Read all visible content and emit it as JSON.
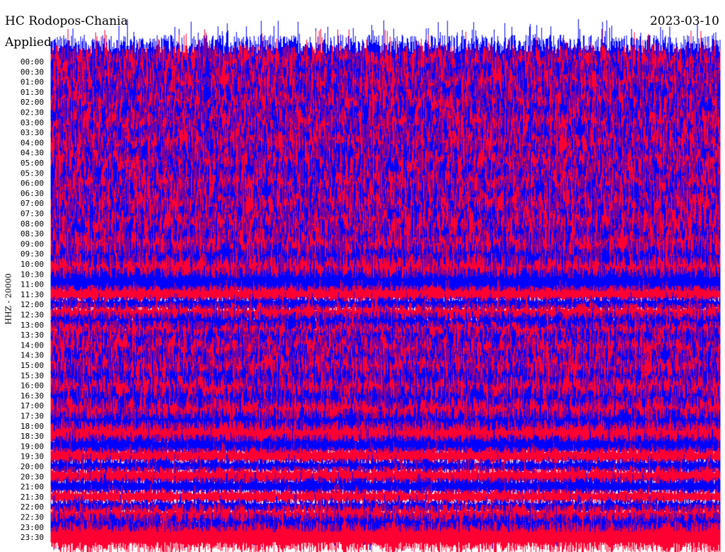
{
  "header": {
    "station": "HC Rodopos-Chania",
    "filter_label": "Applied",
    "date": "2023-03-10"
  },
  "chart_data": {
    "type": "line",
    "title": "HC Rodopos-Chania",
    "date": "2023-03-10",
    "ylabel": "HHZ - 20000",
    "row_labels": [
      "00:00",
      "00:30",
      "01:00",
      "01:30",
      "02:00",
      "02:30",
      "03:00",
      "03:30",
      "04:00",
      "04:30",
      "05:00",
      "05:30",
      "06:00",
      "06:30",
      "07:00",
      "07:30",
      "08:00",
      "08:30",
      "09:00",
      "09:30",
      "10:00",
      "10:30",
      "11:00",
      "11:30",
      "12:00",
      "12:30",
      "13:00",
      "13:30",
      "14:00",
      "14:30",
      "15:00",
      "15:30",
      "16:00",
      "16:30",
      "17:00",
      "17:30",
      "18:00",
      "18:30",
      "19:00",
      "19:30",
      "20:00",
      "20:30",
      "21:00",
      "21:30",
      "22:00",
      "22:30",
      "23:00",
      "23:30"
    ],
    "relative_amplitude": [
      1,
      1,
      1,
      1,
      1,
      1,
      1,
      1,
      1,
      1,
      1,
      1,
      1,
      1,
      1,
      1,
      1,
      1,
      1,
      1,
      0.9,
      0.8,
      0.7,
      0.35,
      0.3,
      0.45,
      0.5,
      0.55,
      0.7,
      0.8,
      0.85,
      0.9,
      0.9,
      0.85,
      0.8,
      0.75,
      0.7,
      0.6,
      0.45,
      0.35,
      0.3,
      0.4,
      0.35,
      0.3,
      0.3,
      0.5,
      0.55,
      0.6
    ],
    "series_colors": [
      "#0000ff",
      "#ff0033"
    ]
  }
}
